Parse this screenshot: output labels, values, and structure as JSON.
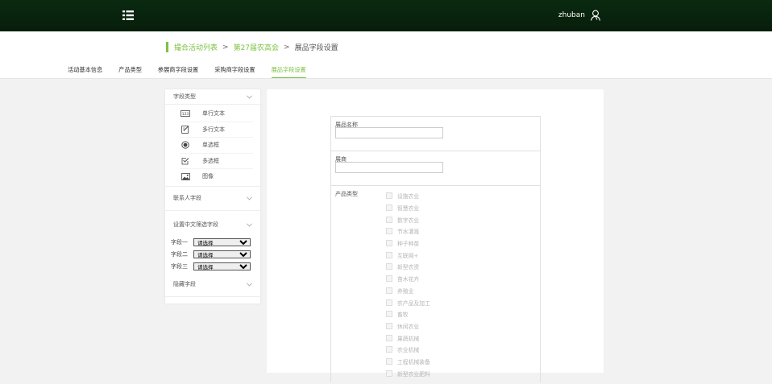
{
  "header": {
    "username": "zhuban"
  },
  "breadcrumb": {
    "items": [
      "撮合活动列表",
      "第27届农高会"
    ],
    "separator": ">",
    "current": "展品字段设置"
  },
  "tabs": [
    {
      "label": "活动基本信息",
      "active": false
    },
    {
      "label": "产品类型",
      "active": false
    },
    {
      "label": "参展商字段设置",
      "active": false
    },
    {
      "label": "采购商字段设置",
      "active": false
    },
    {
      "label": "展品字段设置",
      "active": true
    }
  ],
  "sidebar": {
    "field_type_title": "字段类型",
    "field_types": [
      {
        "label": "单行文本",
        "icon": "text-single-icon"
      },
      {
        "label": "多行文本",
        "icon": "text-multi-icon"
      },
      {
        "label": "单选框",
        "icon": "radio-icon"
      },
      {
        "label": "多选框",
        "icon": "checkbox-icon"
      },
      {
        "label": "图像",
        "icon": "image-icon"
      }
    ],
    "contact_title": "联系人字段",
    "chinese_filter_title": "设置中文筛选字段",
    "filters": [
      {
        "label": "字段一",
        "value": "请选择"
      },
      {
        "label": "字段二",
        "value": "请选择"
      },
      {
        "label": "字段三",
        "value": "请选择"
      }
    ],
    "hidden_title": "隐藏字段"
  },
  "form": {
    "name_label": "展品名称",
    "exhibitor_label": "展商",
    "product_type_label": "产品类型",
    "product_types": [
      "设施农业",
      "智慧农业",
      "数字农业",
      "节水灌溉",
      "种子种苗",
      "互联网+",
      "新型农资",
      "苗木花卉",
      "养殖业",
      "农产品及加工",
      "畜牧",
      "休闲农业",
      "果蔬机械",
      "农业机械",
      "工程机械装备",
      "新型农业肥料"
    ]
  },
  "colors": {
    "accent": "#7cc242",
    "topbar": "#0a2a10"
  }
}
